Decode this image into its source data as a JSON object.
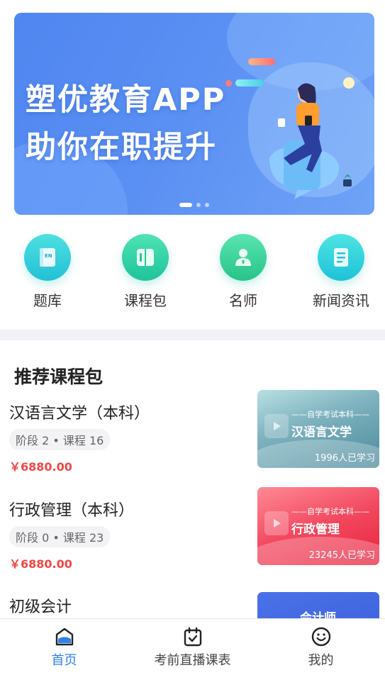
{
  "banner": {
    "line1": "塑优教育APP",
    "line2": "助你在职提升",
    "slide_count": 3,
    "active_slide": 1
  },
  "quicknav": [
    {
      "label": "题库",
      "icon": "book-en-icon"
    },
    {
      "label": "课程包",
      "icon": "course-pack-icon"
    },
    {
      "label": "名师",
      "icon": "teacher-icon"
    },
    {
      "label": "新闻资讯",
      "icon": "news-icon"
    }
  ],
  "section": {
    "title": "推荐课程包"
  },
  "courses": [
    {
      "title": "汉语言文学（本科）",
      "meta": "阶段 2 • 课程 16",
      "price": "￥6880.00",
      "thumb_tag": "——自学考试本科——",
      "thumb_title": "汉语言文学",
      "learners": "1996人已学习"
    },
    {
      "title": "行政管理（本科）",
      "meta": "阶段 0 • 课程 23",
      "price": "￥6880.00",
      "thumb_tag": "——自学考试本科——",
      "thumb_title": "行政管理",
      "learners": "23245人已学习"
    },
    {
      "title": "初级会计",
      "thumb_title": "会计师"
    }
  ],
  "tabbar": [
    {
      "label": "首页",
      "icon": "home-icon",
      "active": true
    },
    {
      "label": "考前直播课表",
      "icon": "calendar-icon",
      "active": false
    },
    {
      "label": "我的",
      "icon": "profile-smile-icon",
      "active": false
    }
  ],
  "colors": {
    "accent": "#2f80e8",
    "price": "#f04646",
    "banner": "#5a8ff3",
    "teal": "#22c1d6"
  }
}
